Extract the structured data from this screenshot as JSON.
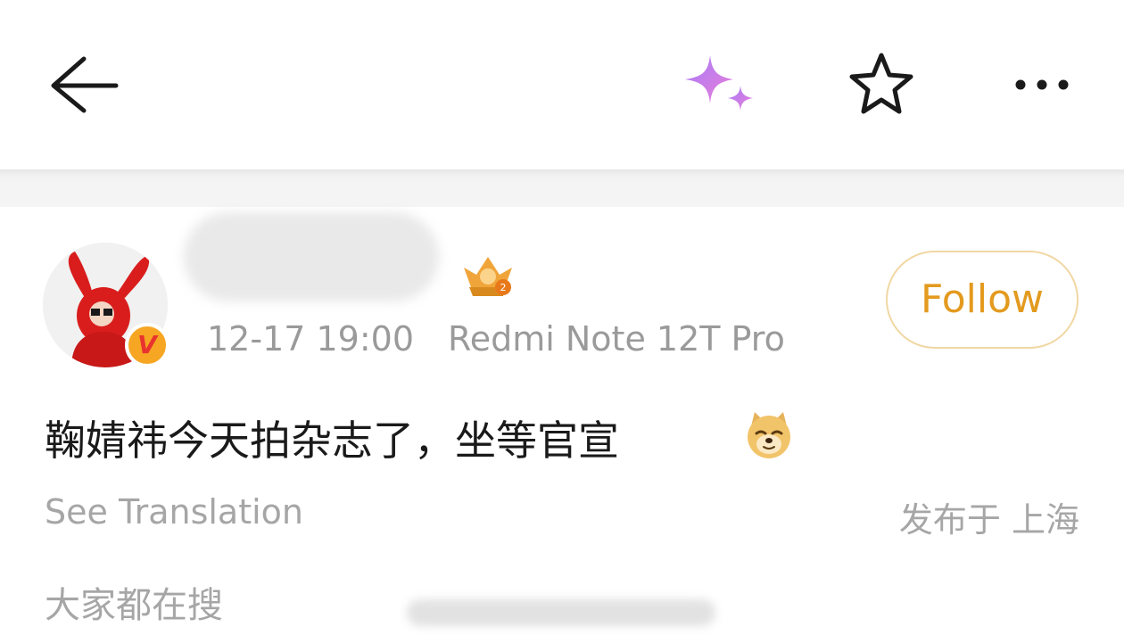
{
  "topbar": {
    "back_icon": "back-arrow-icon",
    "ai_icon": "sparkle-icon",
    "favorite_icon": "star-icon",
    "more_icon": "more-dots-icon",
    "ai_gradient": [
      "#b37cf5",
      "#e27de0"
    ]
  },
  "post": {
    "author": {
      "name": "",
      "verified_badge": "V",
      "verified_color": "#f6a623",
      "level_badge_icon": "crown-level-badge-icon"
    },
    "timestamp": "12-17 19:00",
    "device": "Redmi Note 12T Pro",
    "follow_label": "Follow",
    "text": "鞠婧祎今天拍杂志了，坐等官宣",
    "emoji_icon": "doge-emoji-icon",
    "see_translation": "See Translation",
    "location": "发布于 上海"
  },
  "hot_search": {
    "label": "大家都在搜"
  },
  "colors": {
    "accent": "#e39a1e",
    "follow_border": "#f1d7a3",
    "secondary_text": "#a6a6a6"
  }
}
